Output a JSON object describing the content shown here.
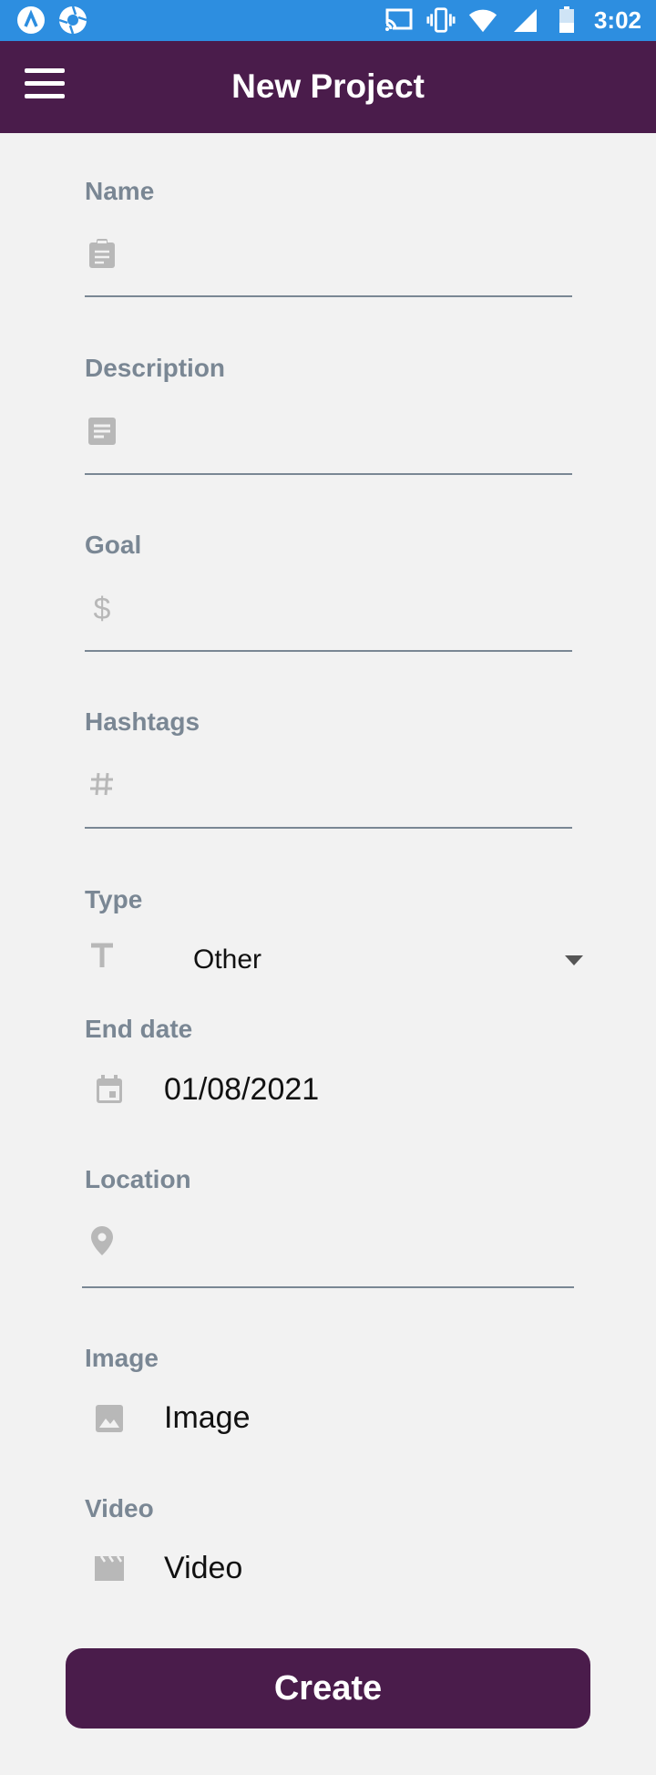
{
  "status_bar": {
    "time": "3:02",
    "icons": [
      "app-a-icon",
      "shutter-icon",
      "cast-icon",
      "vibrate-icon",
      "wifi-icon",
      "signal-icon",
      "battery-icon"
    ]
  },
  "header": {
    "title": "New Project",
    "menu_icon": "hamburger-menu-icon"
  },
  "form": {
    "name": {
      "label": "Name",
      "icon": "clipboard-icon",
      "value": ""
    },
    "description": {
      "label": "Description",
      "icon": "notes-icon",
      "value": ""
    },
    "goal": {
      "label": "Goal",
      "icon": "dollar-icon",
      "value": ""
    },
    "hashtags": {
      "label": "Hashtags",
      "icon": "hashtag-icon",
      "value": ""
    },
    "type": {
      "label": "Type",
      "icon": "text-t-icon",
      "selected": "Other"
    },
    "end_date": {
      "label": "End date",
      "icon": "calendar-icon",
      "value": "01/08/2021"
    },
    "location": {
      "label": "Location",
      "icon": "location-pin-icon",
      "value": ""
    },
    "image": {
      "label": "Image",
      "icon": "image-icon",
      "value": "Image"
    },
    "video": {
      "label": "Video",
      "icon": "video-clapper-icon",
      "value": "Video"
    }
  },
  "actions": {
    "create_label": "Create"
  },
  "colors": {
    "status_bar": "#2d8ee0",
    "app_bar": "#4a1c4b",
    "label": "#7a8794",
    "icon": "#b8b8b8",
    "background": "#f2f2f2"
  }
}
